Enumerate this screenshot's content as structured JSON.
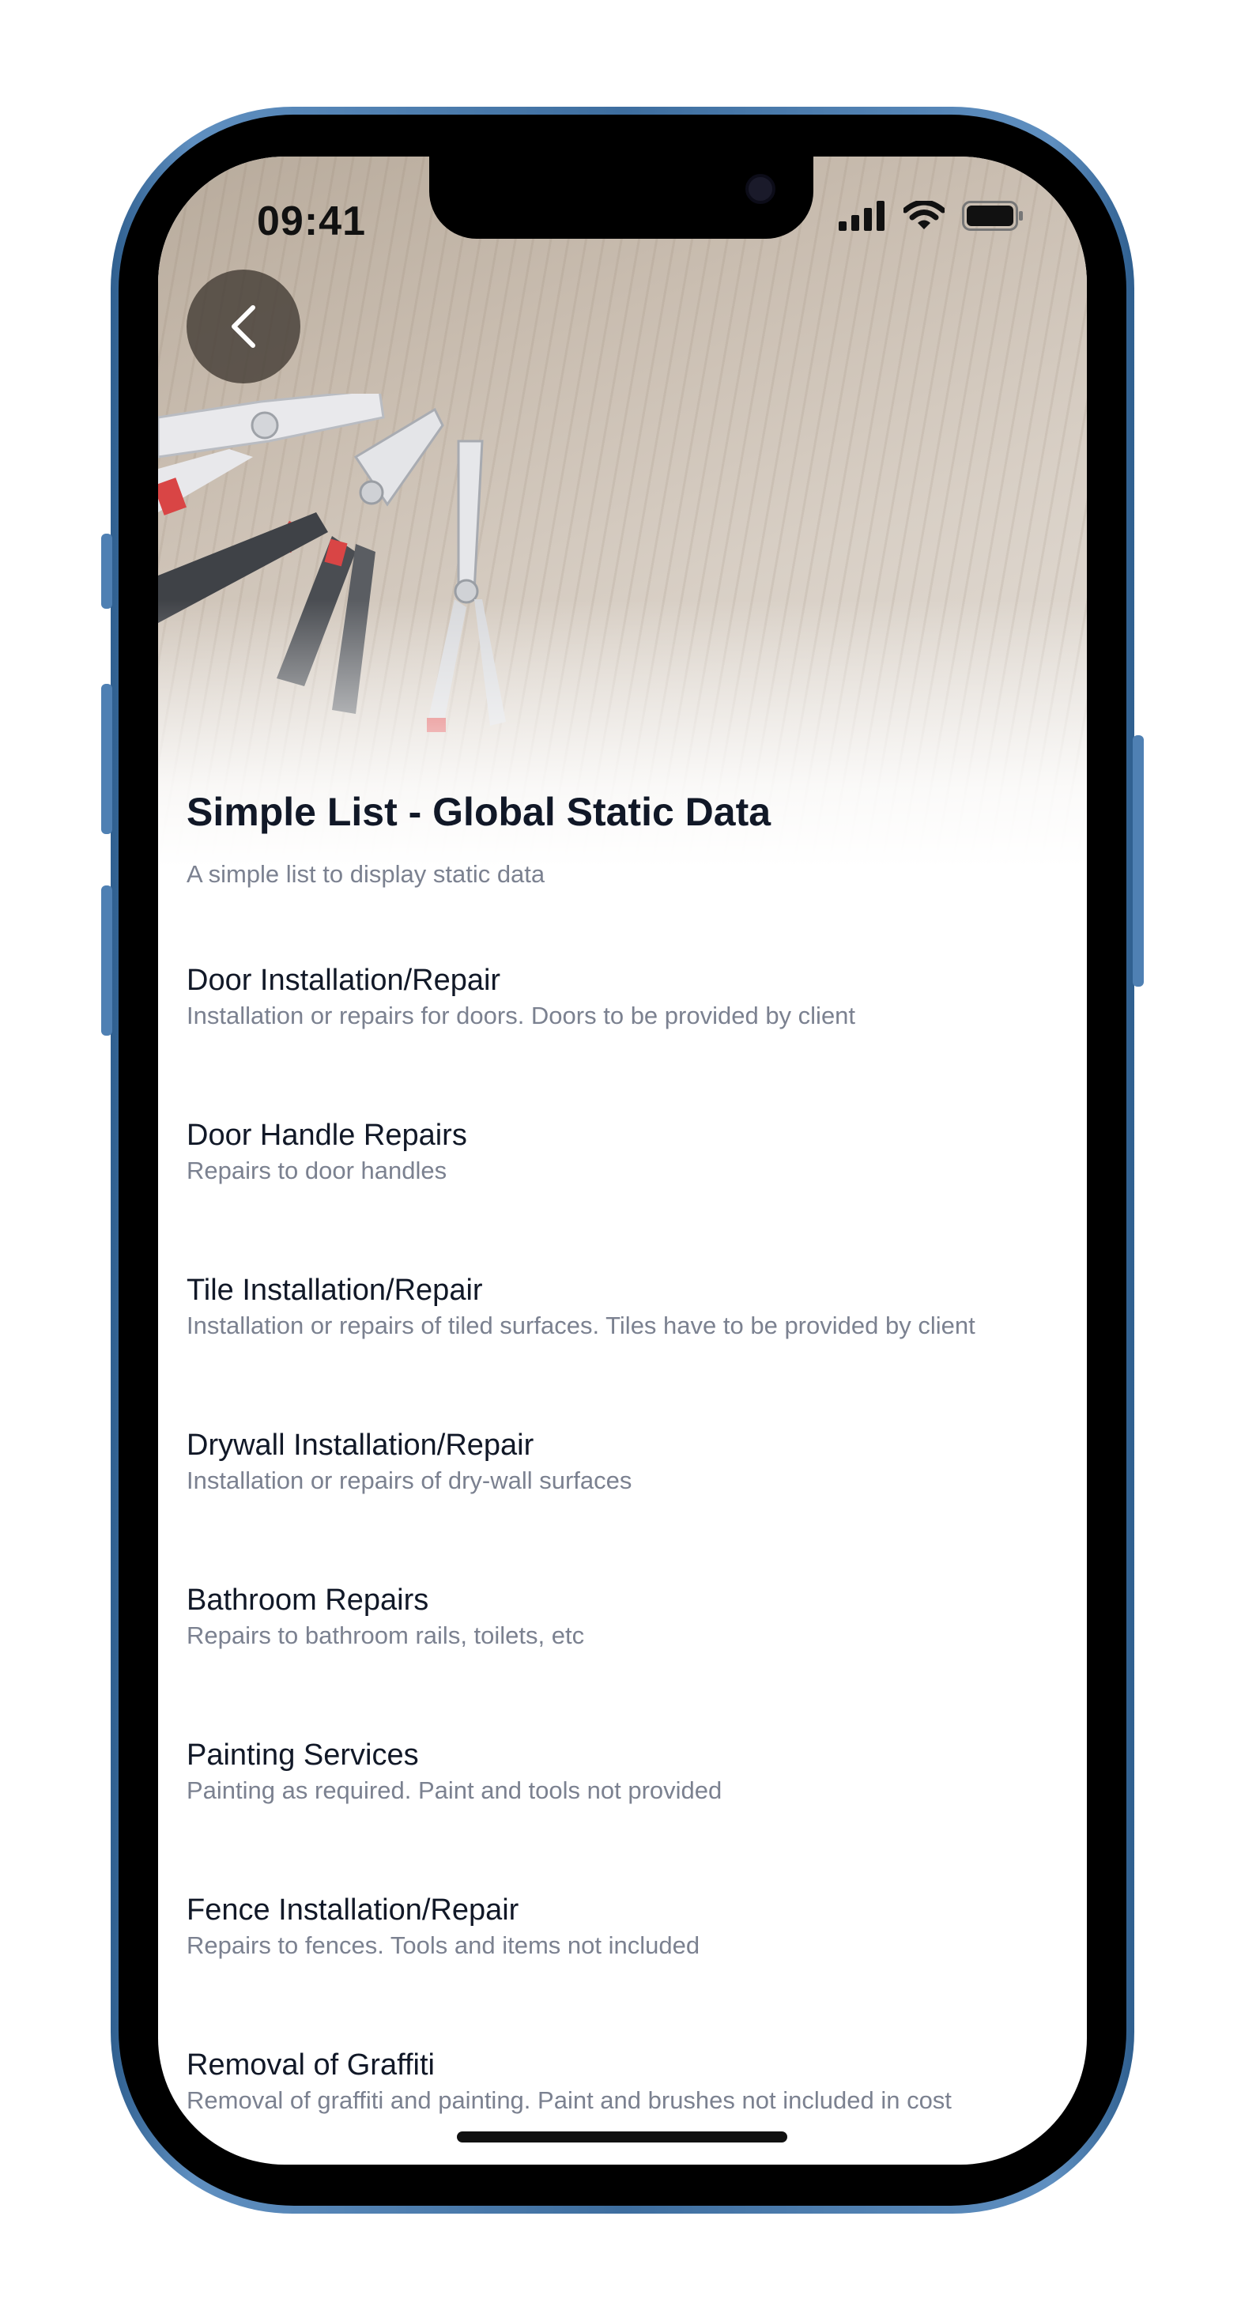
{
  "status_bar": {
    "time": "09:41",
    "icons": [
      "signal-icon",
      "wifi-icon",
      "battery-icon"
    ]
  },
  "header": {
    "back_icon": "chevron-left-icon",
    "title": "Simple List - Global Static Data",
    "subtitle": "A simple list to display static data"
  },
  "items": [
    {
      "title": "Door Installation/Repair",
      "description": "Installation or repairs for doors. Doors to be provided by client"
    },
    {
      "title": "Door Handle Repairs",
      "description": "Repairs to door handles"
    },
    {
      "title": "Tile Installation/Repair",
      "description": "Installation or repairs of tiled surfaces. Tiles have to be provided by client"
    },
    {
      "title": "Drywall Installation/Repair",
      "description": "Installation or repairs of dry-wall surfaces"
    },
    {
      "title": "Bathroom Repairs",
      "description": "Repairs to bathroom rails, toilets, etc"
    },
    {
      "title": "Painting Services",
      "description": "Painting as required. Paint and tools not provided"
    },
    {
      "title": "Fence Installation/Repair",
      "description": "Repairs to fences. Tools and items not included"
    },
    {
      "title": "Removal of Graffiti",
      "description": "Removal of graffiti and painting. Paint and brushes not included in cost"
    }
  ],
  "colors": {
    "title": "#111827",
    "secondary_text": "#7b8190",
    "frame": "#4f80b3"
  }
}
